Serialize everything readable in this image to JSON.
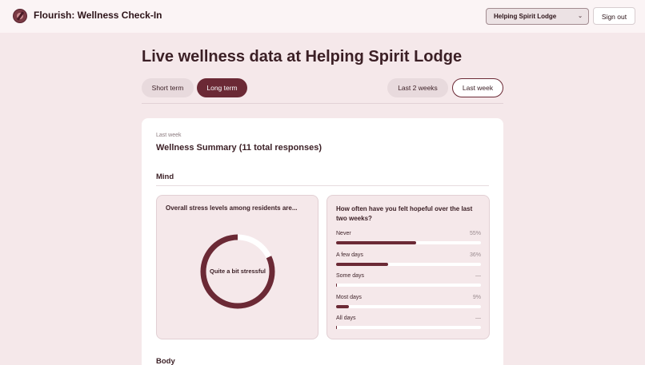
{
  "header": {
    "app_title": "Flourish: Wellness Check-In",
    "location_select": {
      "selected": "Helping Spirit Lodge"
    },
    "sign_out_label": "Sign out"
  },
  "page": {
    "title": "Live wellness data at Helping Spirit Lodge",
    "term_tabs": [
      {
        "label": "Short term",
        "selected": false
      },
      {
        "label": "Long term",
        "selected": true
      }
    ],
    "range_tabs": [
      {
        "label": "Last 2 weeks",
        "selected": false
      },
      {
        "label": "Last week",
        "selected": true
      }
    ]
  },
  "summary": {
    "eyebrow": "Last week",
    "title": "Wellness Summary (11 total responses)",
    "sections": {
      "mind": "Mind",
      "body": "Body"
    }
  },
  "stress_card": {
    "question": "Overall stress levels among residents are...",
    "donut_label": "Quite a bit stressful",
    "donut_fill_fraction": 0.82
  },
  "hope_card": {
    "question": "How often have you felt hopeful over the last two weeks?",
    "rows": [
      {
        "label": "Never",
        "pct_text": "55%",
        "value": 55
      },
      {
        "label": "A few days",
        "pct_text": "36%",
        "value": 36
      },
      {
        "label": "Some days",
        "pct_text": "—",
        "value": 0
      },
      {
        "label": "Most days",
        "pct_text": "9%",
        "value": 9
      },
      {
        "label": "All days",
        "pct_text": "—",
        "value": 0
      }
    ]
  },
  "colors": {
    "accent": "#6b2935",
    "background": "#f5e8ea",
    "card": "#ffffff"
  }
}
